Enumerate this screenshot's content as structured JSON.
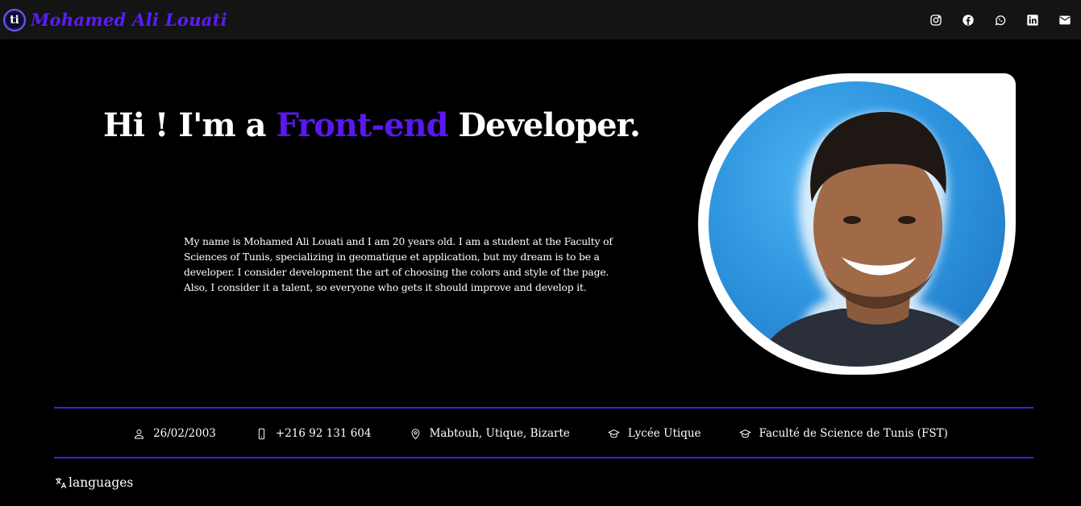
{
  "navbar": {
    "logo_text": "ti",
    "brand_name": "Mohamed Ali Louati",
    "socials": [
      {
        "name": "instagram-icon"
      },
      {
        "name": "facebook-icon"
      },
      {
        "name": "whatsapp-icon"
      },
      {
        "name": "linkedin-icon"
      },
      {
        "name": "mail-icon"
      }
    ]
  },
  "hero": {
    "title_before": "Hi ! I'm a ",
    "title_accent": "Front-end",
    "title_after": " Developer.",
    "bio_line1": "My name is Mohamed Ali Louati and I am 20 years old. I am a student at the Faculty of Sciences of Tunis, specializing in geomatique et application, but my dream is to be a developer. I consider development the art of choosing the colors and style of the page.",
    "bio_line2": "Also, I consider it a talent, so everyone who gets it should improve and develop it."
  },
  "info": {
    "birthdate": "26/02/2003",
    "phone": "+216 92 131 604",
    "address": "Mabtouh, Utique, Bizarte",
    "school": "Lycée Utique",
    "faculty": "Faculté de Science de Tunis (FST)"
  },
  "languages": {
    "label": "languages"
  },
  "colors": {
    "accent": "#5b17f0",
    "divider": "#4a1ae6",
    "background": "#000000",
    "navbar": "#141414"
  }
}
